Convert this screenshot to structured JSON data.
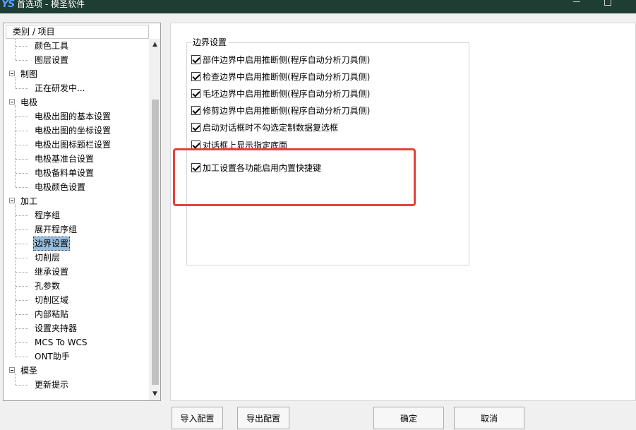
{
  "window": {
    "title": "首选项 - 模圣软件",
    "app_icon_text": "YS"
  },
  "tree": {
    "header": "类别 / 项目",
    "categories": [
      {
        "label": "",
        "children": [
          "颜色工具",
          "图层设置"
        ]
      },
      {
        "label": "制图",
        "children": [
          "正在研发中..."
        ]
      },
      {
        "label": "电极",
        "children": [
          "电极出图的基本设置",
          "电极出图的坐标设置",
          "电极出图标题栏设置",
          "电极基准台设置",
          "电极备料单设置",
          "电极颜色设置"
        ]
      },
      {
        "label": "加工",
        "children": [
          "程序组",
          "展开程序组",
          "边界设置",
          "切削层",
          "继承设置",
          "孔参数",
          "切削区域",
          "内部粘贴",
          "设置夹持器",
          "MCS To WCS",
          "ONT助手"
        ]
      },
      {
        "label": "模圣",
        "children": [
          "更新提示"
        ]
      }
    ],
    "selected": "边界设置"
  },
  "group": {
    "title": "边界设置",
    "options": [
      {
        "label": "部件边界中启用推断侧(程序自动分析刀具侧)",
        "checked": true
      },
      {
        "label": "检查边界中启用推断侧(程序自动分析刀具侧)",
        "checked": true
      },
      {
        "label": "毛坯边界中启用推断侧(程序自动分析刀具侧)",
        "checked": true
      },
      {
        "label": "修剪边界中启用推断侧(程序自动分析刀具侧)",
        "checked": true
      },
      {
        "label": "启动对话框时不勾选定制数据复选框",
        "checked": true
      },
      {
        "label": "对话框上显示指定底面",
        "checked": true
      },
      {
        "label": "加工设置各功能启用内置快捷键",
        "checked": true
      }
    ]
  },
  "buttons": {
    "import": "导入配置",
    "export": "导出配置",
    "ok": "确定",
    "cancel": "取消"
  },
  "colors": {
    "titlebar": "#1e3d33",
    "selection": "#99bedd",
    "highlight": "#e8413b"
  }
}
